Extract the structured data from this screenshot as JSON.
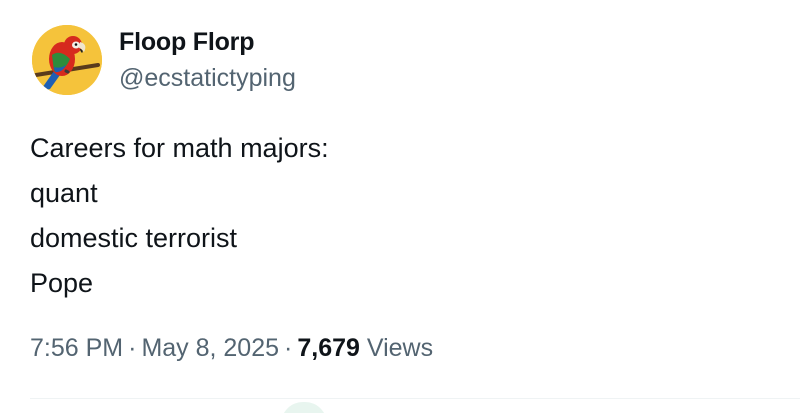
{
  "tweet": {
    "author": {
      "display_name": "Floop Florp",
      "handle": "@ecstatictyping",
      "avatar_icon": "parrot-avatar-icon"
    },
    "body_lines": [
      "Careers for math majors:",
      "quant",
      "domestic terrorist",
      "Pope"
    ],
    "meta": {
      "time": "7:56 PM",
      "separator": "·",
      "date": "May 8, 2025",
      "views_count": "7,679",
      "views_label": "Views"
    }
  },
  "colors": {
    "text_primary": "#0f1419",
    "text_secondary": "#536471",
    "avatar_background": "#f5c33b",
    "divider": "#eff3f4"
  }
}
